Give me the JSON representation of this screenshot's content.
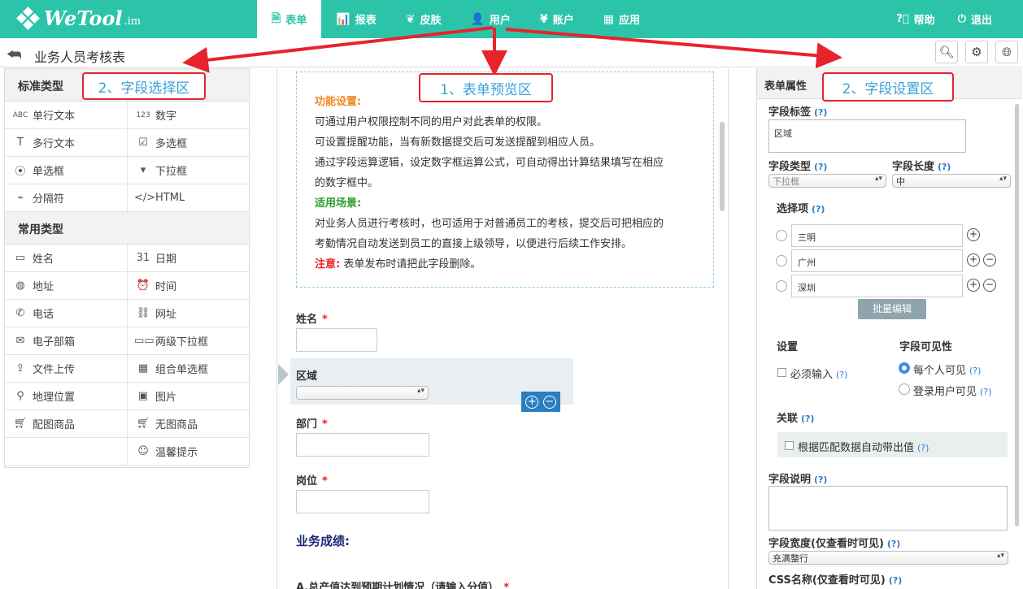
{
  "app": {
    "logo_text": "WeTool",
    "logo_suffix": ".im"
  },
  "nav": [
    {
      "label": "表单",
      "icon": "document-icon",
      "glyph": "🗎"
    },
    {
      "label": "报表",
      "icon": "bar-chart-icon",
      "glyph": "📊"
    },
    {
      "label": "皮肤",
      "icon": "palette-icon",
      "glyph": "❦"
    },
    {
      "label": "用户",
      "icon": "user-icon",
      "glyph": "👤"
    },
    {
      "label": "账户",
      "icon": "yen-icon",
      "glyph": "¥"
    },
    {
      "label": "应用",
      "icon": "grid-icon",
      "glyph": "▦"
    }
  ],
  "right_nav": {
    "help": "帮助",
    "logout": "退出"
  },
  "page_title": "业务人员考核表",
  "left": {
    "std_header": "标准类型",
    "std_fields": [
      "单行文本",
      "数字",
      "多行文本",
      "多选框",
      "单选框",
      "下拉框",
      "分隔符",
      "HTML"
    ],
    "common_header": "常用类型",
    "common_fields": [
      "姓名",
      "日期",
      "地址",
      "时间",
      "电话",
      "网址",
      "电子部箱",
      "两级下拉框",
      "文件上传",
      "组合单选框",
      "地理位置",
      "图片",
      "配图商品",
      "无图商品",
      "",
      "温馨提示"
    ]
  },
  "annotations": {
    "field_select": "2、字段选择区",
    "form_preview": "1、表单预览区",
    "field_settings": "2、字段设置区"
  },
  "notice": {
    "title1": "功能设置:",
    "l1": "可通过用户权限控制不同的用户对此表单的权限。",
    "l2": "可设置提醒功能，当有新数据提交后可发送提醒到相应人员。",
    "l3": "通过字段运算逻辑，设定数字框运算公式，可自动得出计算结果填写在相应",
    "l4": "的数字框中。",
    "title2": "适用场景:",
    "l5": "对业务人员进行考核时，也可适用于对普通员工的考核，提交后可把相应的",
    "l6": "考勤情况自动发送到员工的直接上级领导，以便进行后续工作安排。",
    "note_label": "注意:",
    "note": "表单发布时请把此字段删除。"
  },
  "form": {
    "name": "姓名",
    "region": "区域",
    "dept": "部门",
    "position": "岗位",
    "section": "业务成绩:",
    "cut": "A.总产值达到预期计划情况（请输入分值）",
    "req": "*"
  },
  "props": {
    "header": "表单属性",
    "field_label": "字段标签",
    "field_label_value": "区域",
    "field_type": "字段类型",
    "field_type_value": "下拉框",
    "field_len": "字段长度",
    "field_len_value": "中",
    "options_title": "选择项",
    "options": [
      "三明",
      "广州",
      "深圳"
    ],
    "batch_edit": "批量编辑",
    "settings": "设置",
    "visibility": "字段可见性",
    "required": "必须输入",
    "vis_all": "每个人可见",
    "vis_login": "登录用户可见",
    "relation": "关联",
    "auto_fill": "根据匹配数据自动带出值",
    "desc": "字段说明",
    "width": "字段宽度(仅查看时可见)",
    "width_value": "充满整行",
    "css": "CSS名称(仅查看时可见)",
    "q": "(?)"
  }
}
